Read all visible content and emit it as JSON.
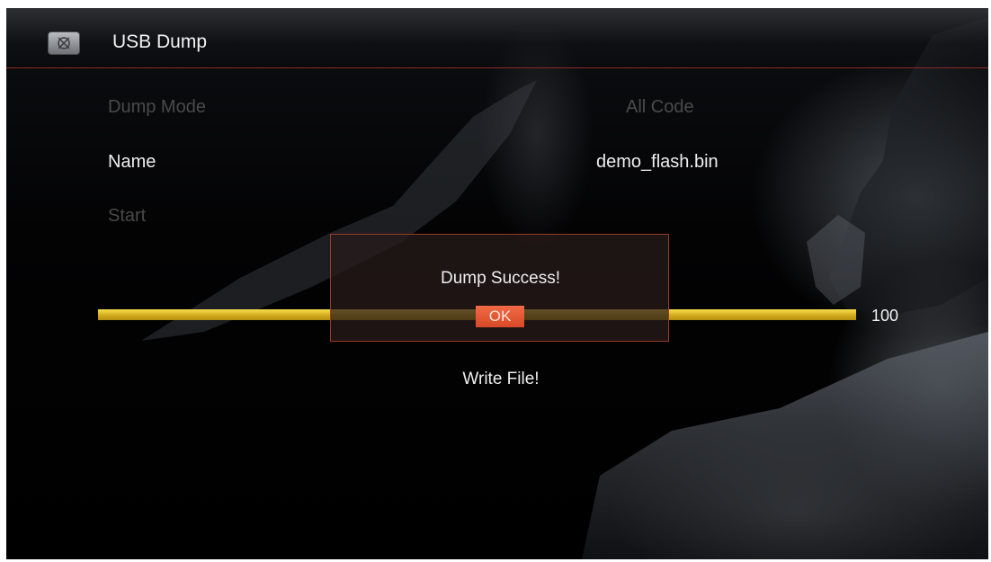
{
  "header": {
    "title": "USB Dump",
    "icon": "tools-icon"
  },
  "rows": {
    "dump_mode": {
      "label": "Dump Mode",
      "value": "All Code"
    },
    "name": {
      "label": "Name",
      "value": "demo_flash.bin"
    },
    "start": {
      "label": "Start"
    }
  },
  "progress": {
    "fraction": 1.0,
    "value_text": "100"
  },
  "dialog": {
    "message": "Dump Success!",
    "ok_label": "OK"
  },
  "status": "Write File!",
  "colors": {
    "accent": "#d94a27",
    "progress": "#e8c531",
    "divider": "#8a2a22"
  }
}
